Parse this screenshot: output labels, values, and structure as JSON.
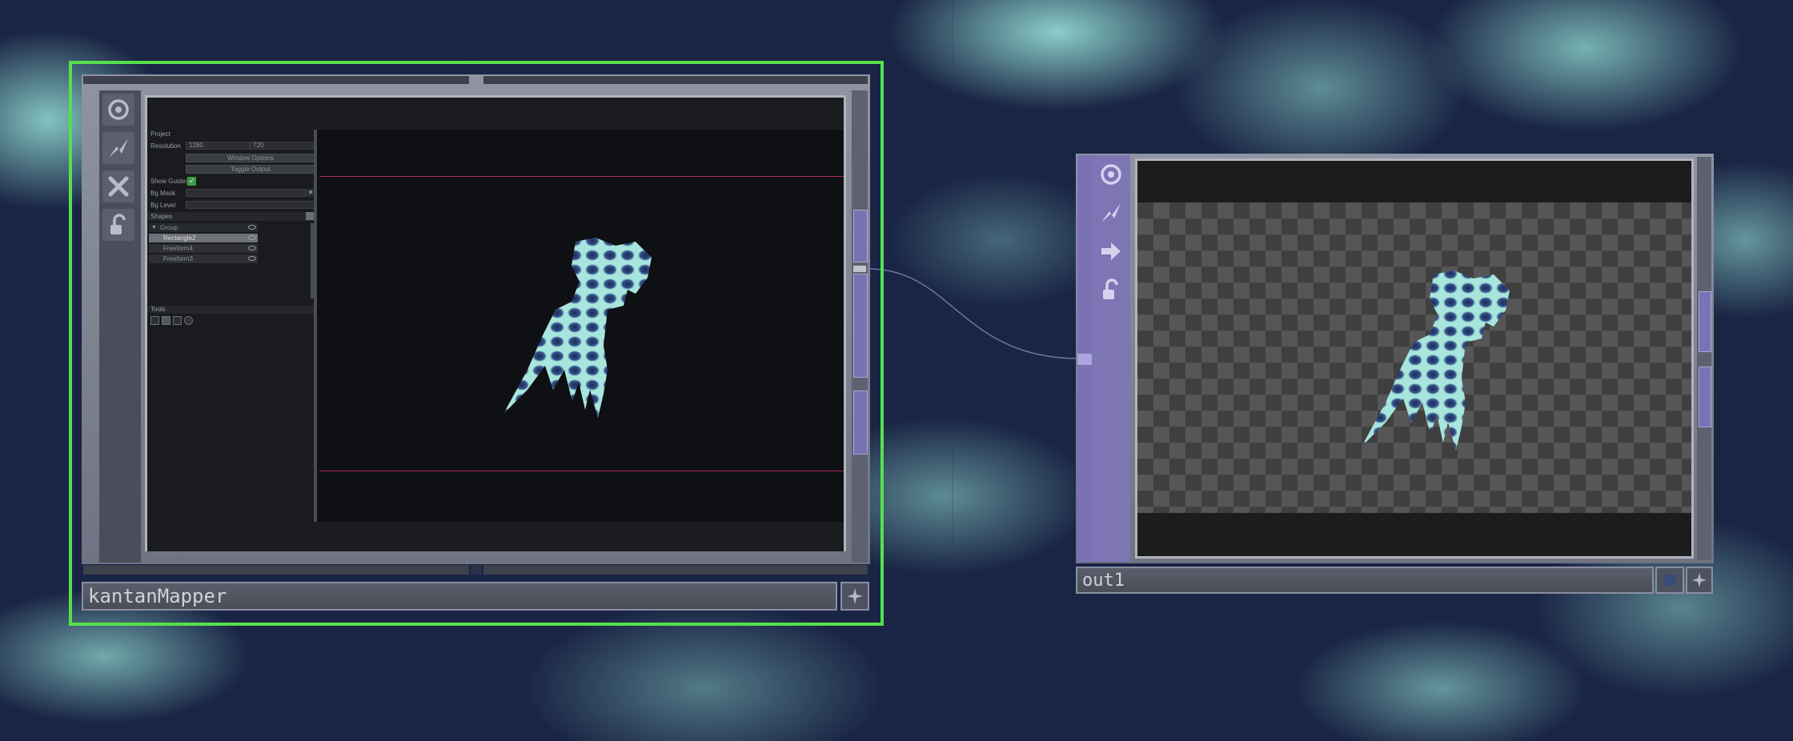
{
  "nodes": {
    "kantanmapper": {
      "name": "kantanMapper",
      "panel": {
        "project_header": "Project",
        "resolution_label": "Resolution",
        "resolution_w": "1280",
        "resolution_h": "720",
        "window_options_label": "Window Options",
        "toggle_output_label": "Toggle Output",
        "show_guides_label": "Show Guides",
        "bg_mask_label": "Bg Mask",
        "bg_level_label": "Bg Level",
        "shapes_header": "Shapes",
        "shapes": [
          {
            "label": "Group"
          },
          {
            "label": "Rectangle2"
          },
          {
            "label": "Freeform4"
          },
          {
            "label": "Freeform3"
          }
        ],
        "tools_header": "Tools"
      }
    },
    "out1": {
      "name": "out1"
    }
  },
  "icons": {
    "viewer": "target-icon",
    "bypass": "lightning-icon",
    "delete": "x-icon",
    "lock": "lock-icon",
    "output": "arrow-right-icon",
    "pin": "star-icon"
  },
  "colors": {
    "selection": "#56e04c",
    "node_frame": "#8f94a2",
    "connector": "#7a72b2",
    "guide_line": "#b4296b"
  }
}
